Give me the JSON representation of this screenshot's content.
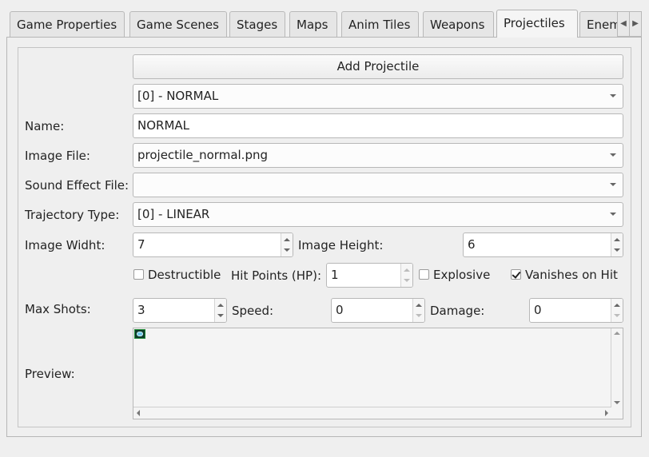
{
  "tabs": [
    {
      "label": "Game Properties"
    },
    {
      "label": "Game Scenes"
    },
    {
      "label": "Stages"
    },
    {
      "label": "Maps"
    },
    {
      "label": "Anim Tiles"
    },
    {
      "label": "Weapons"
    },
    {
      "label": "Projectiles"
    },
    {
      "label": "Enemies"
    }
  ],
  "active_tab": "Projectiles",
  "tab_scroll": {
    "left": "◀",
    "right": "▶"
  },
  "form": {
    "add_button": "Add Projectile",
    "projectile_select": "[0] - NORMAL",
    "name_label": "Name:",
    "name_value": "NORMAL",
    "image_file_label": "Image File:",
    "image_file_value": "projectile_normal.png",
    "sound_label": "Sound Effect File:",
    "sound_value": "",
    "trajectory_label": "Trajectory Type:",
    "trajectory_value": "[0] - LINEAR",
    "image_width_label": "Image Widht:",
    "image_width_value": "7",
    "image_height_label": "Image Height:",
    "image_height_value": "6",
    "destructible_label": "Destructible",
    "destructible_checked": false,
    "hp_label": "Hit Points (HP):",
    "hp_value": "1",
    "explosive_label": "Explosive",
    "explosive_checked": false,
    "vanishes_label": "Vanishes on Hit",
    "vanishes_checked": true,
    "max_shots_label": "Max Shots:",
    "max_shots_value": "3",
    "speed_label": "Speed:",
    "speed_value": "0",
    "damage_label": "Damage:",
    "damage_value": "0",
    "preview_label": "Preview:"
  },
  "icons": {
    "combo_arrow": "chevron-down-icon",
    "spin": "spin-up-down-icon",
    "preview_sprite": "projectile-sprite"
  }
}
